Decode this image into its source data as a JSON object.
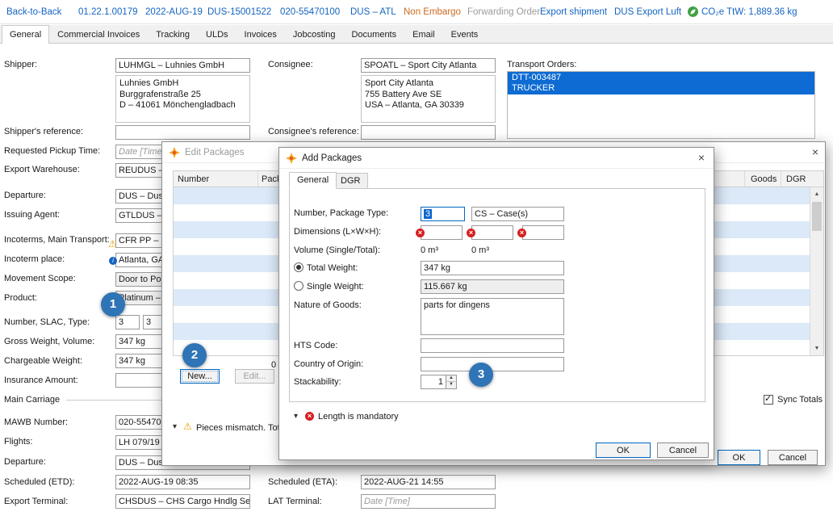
{
  "topbar": {
    "links": [
      "Back-to-Back",
      "01.22.1.00179",
      "2022-AUG-19",
      "DUS-15001522",
      "020-55470100",
      "DUS – ATL"
    ],
    "non_embargo": "Non Embargo",
    "forwarding_order": "Forwarding Order",
    "export_shipment": "Export shipment",
    "dus_export_luft": "DUS Export Luft",
    "co2_badge": "CO₂e TtW: 1,889.36 kg"
  },
  "tabs": {
    "items": [
      "General",
      "Commercial Invoices",
      "Tracking",
      "ULDs",
      "Invoices",
      "Jobcosting",
      "Documents",
      "Email",
      "Events"
    ],
    "selected": "General"
  },
  "form": {
    "shipper": {
      "label": "Shipper:",
      "value": "LUHMGL – Luhnies GmbH",
      "address": "Luhnies GmbH\nBurggrafenstraße 25\nD – 41061 Mönchengladbach"
    },
    "consignee": {
      "label": "Consignee:",
      "value": "SPOATL – Sport City Atlanta",
      "address": "Sport City Atlanta\n755 Battery Ave SE\nUSA – Atlanta, GA 30339"
    },
    "transport_orders": {
      "label": "Transport Orders:",
      "selected_order": "DTT-003487",
      "selected_type": "TRUCKER"
    },
    "shippers_reference": {
      "label": "Shipper's reference:",
      "value": ""
    },
    "consignees_reference": {
      "label": "Consignee's reference:",
      "value": ""
    },
    "requested_pickup_time": {
      "label": "Requested Pickup Time:",
      "placeholder": "Date [Time]"
    },
    "export_warehouse": {
      "label": "Export Warehouse:",
      "value": "REUDUS – Fr"
    },
    "departure": {
      "label": "Departure:",
      "value": "DUS – Dusse"
    },
    "issuing_agent": {
      "label": "Issuing Agent:",
      "value": "GTLDUS – Gl"
    },
    "incoterms_main_transport": {
      "label": "Incoterms, Main Transport:",
      "value": "CFR PP – Co"
    },
    "incoterm_place": {
      "label": "Incoterm place:",
      "value": "Atlanta, GA"
    },
    "movement_scope": {
      "label": "Movement Scope:",
      "value": "Door to Port"
    },
    "product": {
      "label": "Product:",
      "value": "Platinum – F"
    },
    "number_slac_type": {
      "label": "Number, SLAC, Type:",
      "number": "3",
      "slac": "3"
    },
    "gross_weight_volume": {
      "label": "Gross Weight, Volume:",
      "value": "347 kg"
    },
    "chargeable_weight": {
      "label": "Chargeable Weight:",
      "value": "347 kg"
    },
    "insurance_amount": {
      "label": "Insurance Amount:",
      "value": ""
    },
    "main_carriage_section": "Main Carriage",
    "mawb_number": {
      "label": "MAWB Number:",
      "value": "020-55470100"
    },
    "flights": {
      "label": "Flights:",
      "value": "LH 079/19 LH"
    },
    "departure_main_carriage": {
      "label": "Departure:",
      "value": "DUS – Dusse"
    },
    "scheduled_etd": {
      "label": "Scheduled (ETD):",
      "value": "2022-AUG-19 08:35"
    },
    "export_terminal": {
      "label": "Export Terminal:",
      "value": "CHSDUS – CHS Cargo Hndlg Services"
    },
    "scheduled_eta": {
      "label": "Scheduled (ETA):",
      "value": "2022-AUG-21 14:55"
    },
    "lat_terminal": {
      "label": "LAT Terminal:",
      "placeholder": "Date [Time]"
    }
  },
  "edit_packages_dialog": {
    "title": "Edit Packages",
    "columns": {
      "number": "Number",
      "package_type": "Package Type",
      "goods": "Goods",
      "dgr": "DGR"
    },
    "total_count": "0",
    "new_button": "New...",
    "edit_button": "Edit...",
    "warning_message": "Pieces mismatch. Tot",
    "sync_totals_label": "Sync Totals",
    "ok_button": "OK",
    "cancel_button": "Cancel"
  },
  "add_packages_dialog": {
    "title": "Add Packages",
    "tab_general": "General",
    "tab_dgr": "DGR",
    "number_package_type": {
      "label": "Number, Package Type:",
      "number": "3",
      "package_type": "CS – Case(s)"
    },
    "dimensions": {
      "label": "Dimensions (L×W×H):",
      "length": "",
      "width": "",
      "height": ""
    },
    "volume": {
      "label": "Volume (Single/Total):",
      "single": "0 m³",
      "total": "0 m³"
    },
    "total_weight": {
      "label": "Total Weight:",
      "value": "347 kg"
    },
    "single_weight": {
      "label": "Single Weight:",
      "value": "115.667 kg"
    },
    "nature_of_goods": {
      "label": "Nature of Goods:",
      "value": "parts for dingens"
    },
    "hts_code": {
      "label": "HTS Code:",
      "value": ""
    },
    "country_of_origin": {
      "label": "Country of Origin:",
      "value": ""
    },
    "stackability": {
      "label": "Stackability:",
      "value": "1"
    },
    "error_message": "Length is mandatory",
    "ok_button": "OK",
    "cancel_button": "Cancel"
  },
  "annotations": {
    "step_1": "1",
    "step_2": "2",
    "step_3": "3"
  }
}
